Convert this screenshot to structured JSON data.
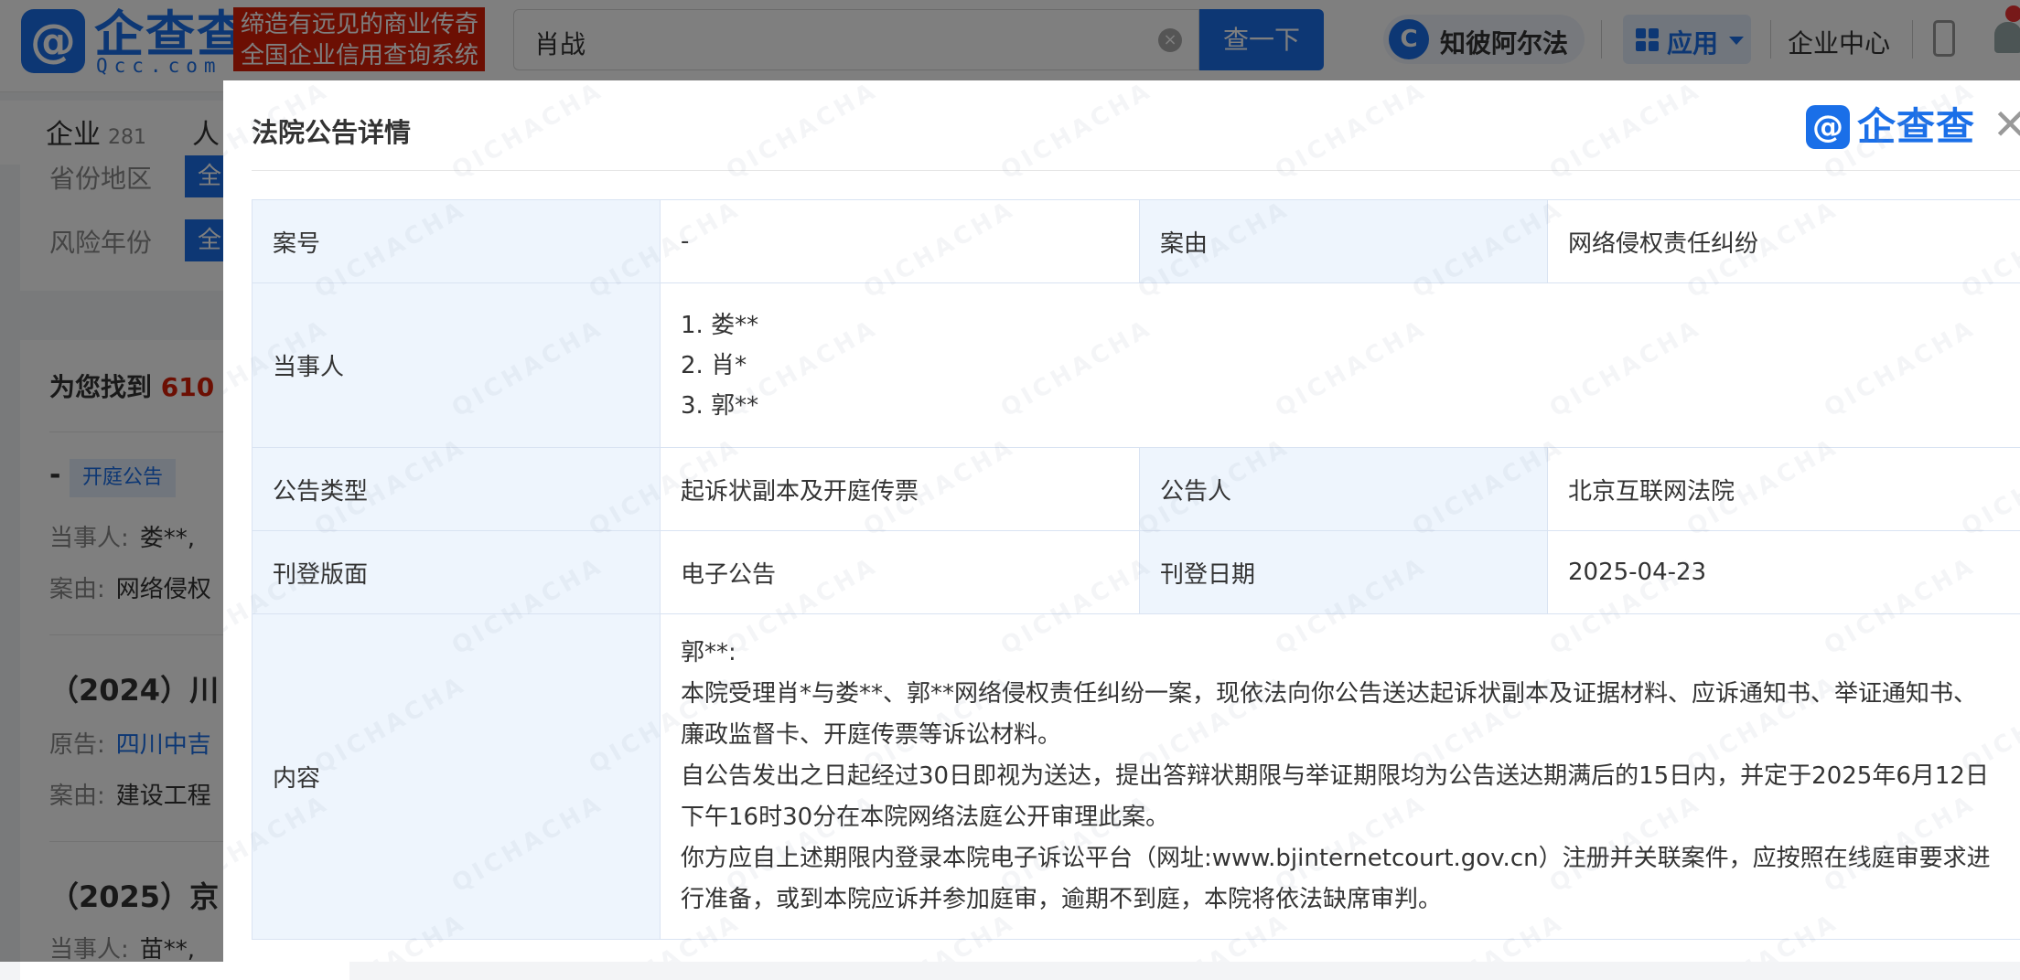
{
  "header": {
    "logo_mark": "@",
    "logo_name": "企查查",
    "logo_sub": "Qcc.com",
    "slogan_line1": "缔造有远见的商业传奇",
    "slogan_line2": "全国企业信用查询系统",
    "search_value": "肖战",
    "search_button": "查一下",
    "zhibi_label": "知彼阿尔法",
    "app_label": "应用",
    "center_link": "企业中心"
  },
  "page": {
    "tabs": [
      {
        "label": "企业",
        "count": "281"
      },
      {
        "label": "人"
      }
    ],
    "filters": [
      {
        "label": "省份地区",
        "value": "全"
      },
      {
        "label": "风险年份",
        "value": "全"
      }
    ],
    "results_prefix": "为您找到",
    "results_count": "610",
    "results": [
      {
        "dash": "-",
        "tag": "开庭公告",
        "party_label": "当事人:",
        "party_value": "娄**,",
        "cause_label": "案由:",
        "cause_value": "网络侵权"
      },
      {
        "title": "（2024）川",
        "plaintiff_label": "原告:",
        "plaintiff_value": "四川中吉",
        "cause_label": "案由:",
        "cause_value": "建设工程"
      },
      {
        "title": "（2025）京",
        "party_label": "当事人:",
        "party_value": "苗**,"
      }
    ]
  },
  "modal": {
    "title": "法院公告详情",
    "logo_name": "企查查",
    "close": "✕",
    "rows": {
      "case_no_label": "案号",
      "case_no_value": "-",
      "cause_label": "案由",
      "cause_value": "网络侵权责任纠纷",
      "parties_label": "当事人",
      "parties": [
        "1. 娄**",
        "2. 肖*",
        "3. 郭**"
      ],
      "notice_type_label": "公告类型",
      "notice_type_value": "起诉状副本及开庭传票",
      "announcer_label": "公告人",
      "announcer_value": "北京互联网法院",
      "layout_label": "刊登版面",
      "layout_value": "电子公告",
      "date_label": "刊登日期",
      "date_value": "2025-04-23",
      "content_label": "内容",
      "content": [
        "郭**:",
        "本院受理肖*与娄**、郭**网络侵权责任纠纷一案，现依法向你公告送达起诉状副本及证据材料、应诉通知书、举证通知书、廉政监督卡、开庭传票等诉讼材料。",
        "自公告发出之日起经过30日即视为送达，提出答辩状期限与举证期限均为公告送达期满后的15日内，并定于2025年6月12日下午16时30分在本院网络法庭公开审理此案。",
        "你方应自上述期限内登录本院电子诉讼平台（网址:www.bjinternetcourt.gov.cn）注册并关联案件，应按照在线庭审要求进行准备，或到本院应诉并参加庭审，逾期不到庭，本院将依法缺席审判。"
      ]
    },
    "watermark_text": "QICHACHA"
  }
}
